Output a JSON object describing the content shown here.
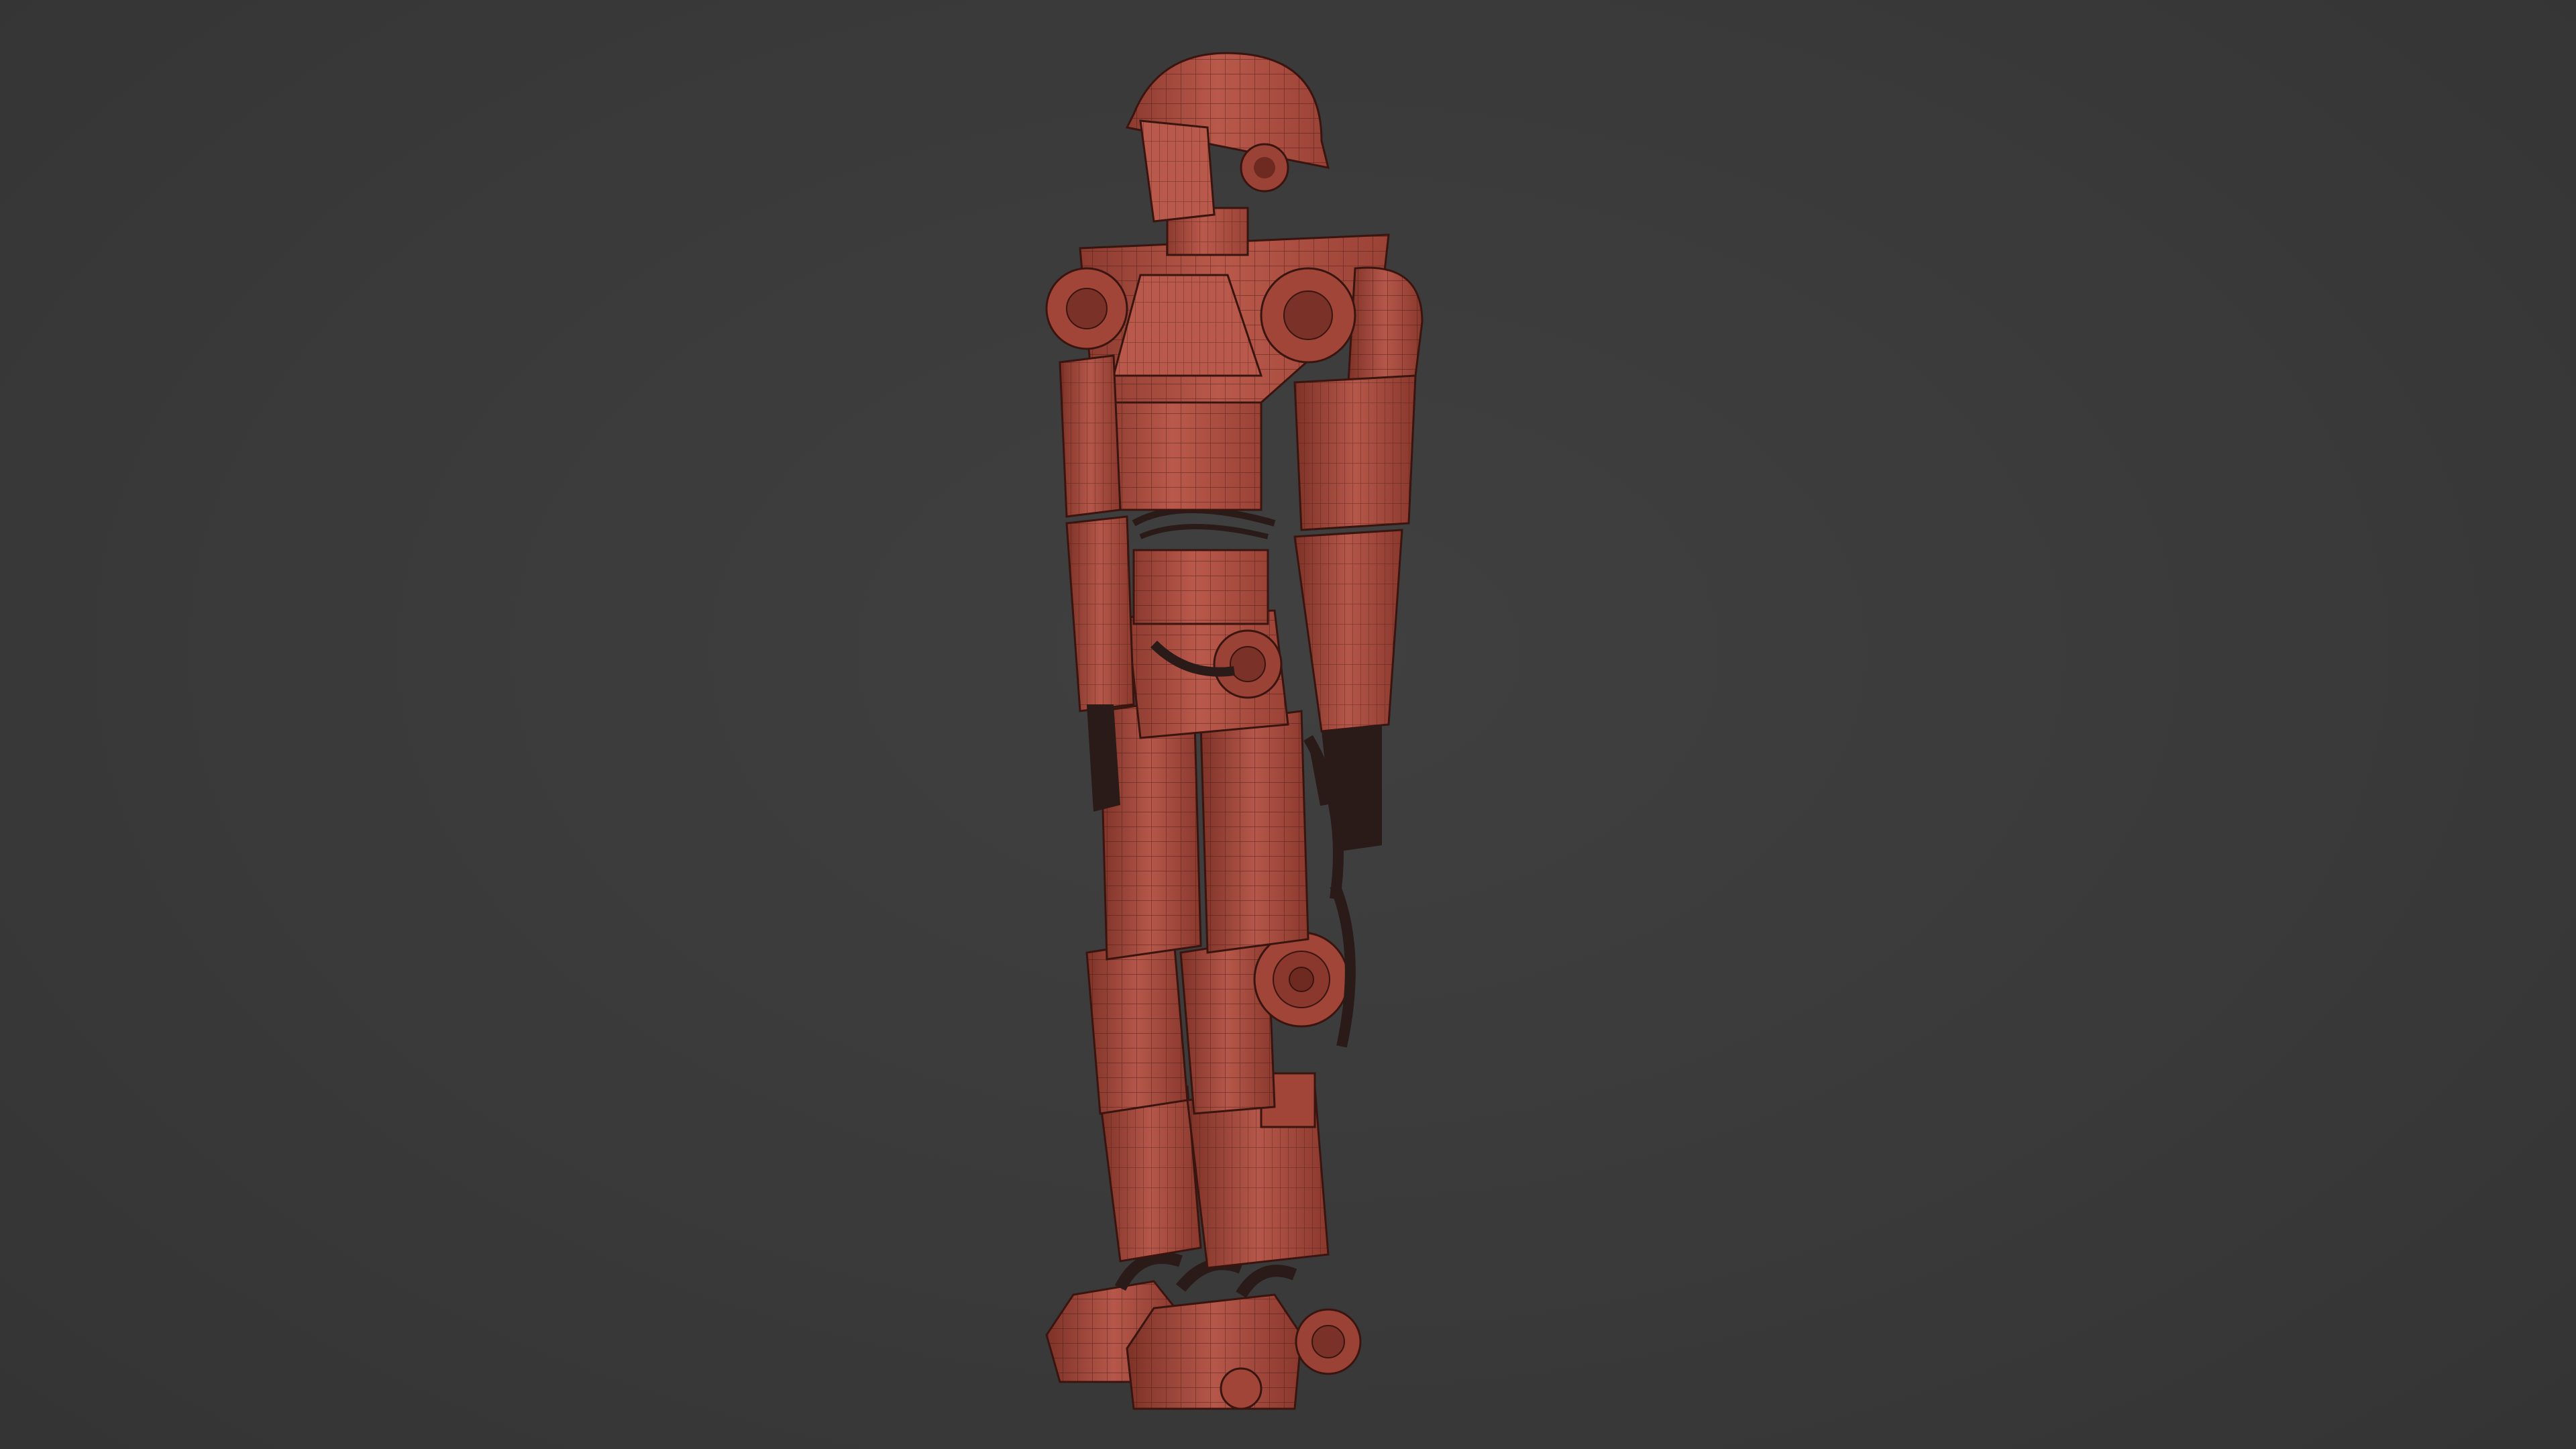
{
  "viewport": {
    "background_color": "#3b3b3b",
    "shading": "solid-wireframe-overlay"
  },
  "model": {
    "subject": "humanoid robot",
    "base_color": "#b5574a",
    "shadow_color": "#7a3128",
    "highlight_color": "#d27a6b",
    "wire_color": "#3a1510",
    "cable_color": "#2a1a18"
  }
}
